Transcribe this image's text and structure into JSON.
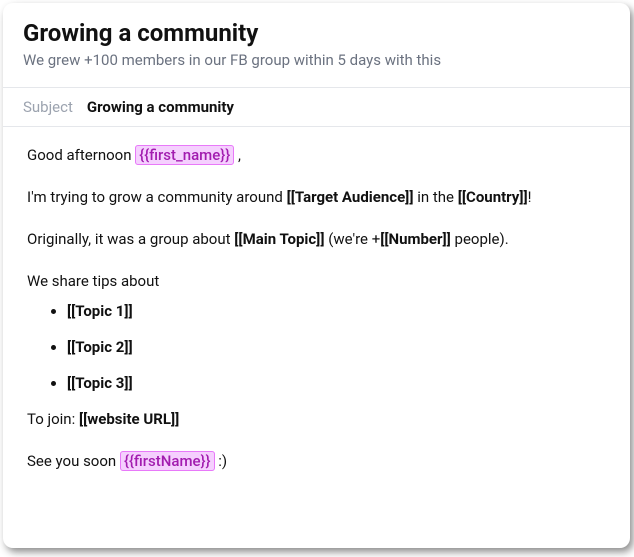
{
  "header": {
    "title": "Growing a community",
    "subtitle": "We grew +100 members in our FB group within 5 days with this"
  },
  "subject": {
    "label": "Subject",
    "value": "Growing a community"
  },
  "body": {
    "greeting_prefix": "Good afternoon ",
    "greeting_var": "{{first_name}}",
    "greeting_suffix": " ,",
    "line2_a": "I'm trying to grow a community around ",
    "line2_target": "[[Target Audience]]",
    "line2_b": " in the ",
    "line2_country": "[[Country]]",
    "line2_c": "!",
    "line3_a": "Originally, it was a group about ",
    "line3_topic": "[[Main Topic]]",
    "line3_b": " (we're +",
    "line3_number": "[[Number]]",
    "line3_c": " people).",
    "share_intro": "We share tips about",
    "topics": {
      "t1": "[[Topic 1]]",
      "t2": "[[Topic 2]]",
      "t3": "[[Topic 3]]"
    },
    "join_a": "To join: ",
    "join_url": "[[website URL]]",
    "closing_a": "See you soon ",
    "closing_var": "{{firstName}}",
    "closing_b": " :)"
  }
}
